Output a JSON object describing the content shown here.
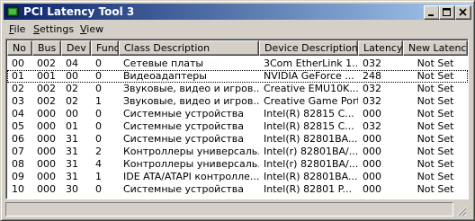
{
  "window": {
    "title": "PCI Latency Tool 3"
  },
  "menu": {
    "items": [
      "File",
      "Settings",
      "View"
    ]
  },
  "columns": [
    "No",
    "Bus",
    "Dev",
    "Func",
    "Class Description",
    "Device Description",
    "Latency",
    "New Latency"
  ],
  "rows": [
    [
      "00",
      "002",
      "04",
      "0",
      "Сетевые платы",
      "3Com EtherLink 1...",
      "032",
      "Not Set"
    ],
    [
      "01",
      "001",
      "00",
      "0",
      "Видеоадаптеры",
      "NVIDIA GeForce ...",
      "248",
      "Not Set"
    ],
    [
      "02",
      "002",
      "02",
      "0",
      "Звуковые, видео и игров...",
      "Creative EMU10K...",
      "032",
      "Not Set"
    ],
    [
      "03",
      "002",
      "02",
      "1",
      "Звуковые, видео и игров...",
      "Creative Game Port",
      "032",
      "Not Set"
    ],
    [
      "04",
      "000",
      "00",
      "0",
      "Системные устройства",
      "Intel(R) 82815 C...",
      "000",
      "Not Set"
    ],
    [
      "05",
      "000",
      "01",
      "0",
      "Системные устройства",
      "Intel(R) 82815 C...",
      "032",
      "Not Set"
    ],
    [
      "06",
      "000",
      "31",
      "0",
      "Системные устройства",
      "Intel(R) 82801BA...",
      "000",
      "Not Set"
    ],
    [
      "07",
      "000",
      "31",
      "2",
      "Контроллеры универсаль...",
      "Intel(r) 82801BA/...",
      "000",
      "Not Set"
    ],
    [
      "08",
      "000",
      "31",
      "4",
      "Контроллеры универсаль...",
      "Intel(r) 82801BA/...",
      "000",
      "Not Set"
    ],
    [
      "09",
      "000",
      "31",
      "1",
      "IDE ATA/ATAPI контролле...",
      "Intel(R) 82801BA...",
      "000",
      "Not Set"
    ],
    [
      "10",
      "000",
      "30",
      "0",
      "Системные устройства",
      "Intel(R) 82801 P...",
      "000",
      "Not Set"
    ]
  ],
  "focused_row": 1,
  "colors": {
    "title_start": "#0a246a",
    "title_end": "#a6caf0",
    "face": "#d4d0c8"
  },
  "icons": {
    "app": "app-chip-icon",
    "minimize": "minimize-icon",
    "maximize": "maximize-icon",
    "close": "close-icon",
    "grip": "size-grip-icon"
  }
}
